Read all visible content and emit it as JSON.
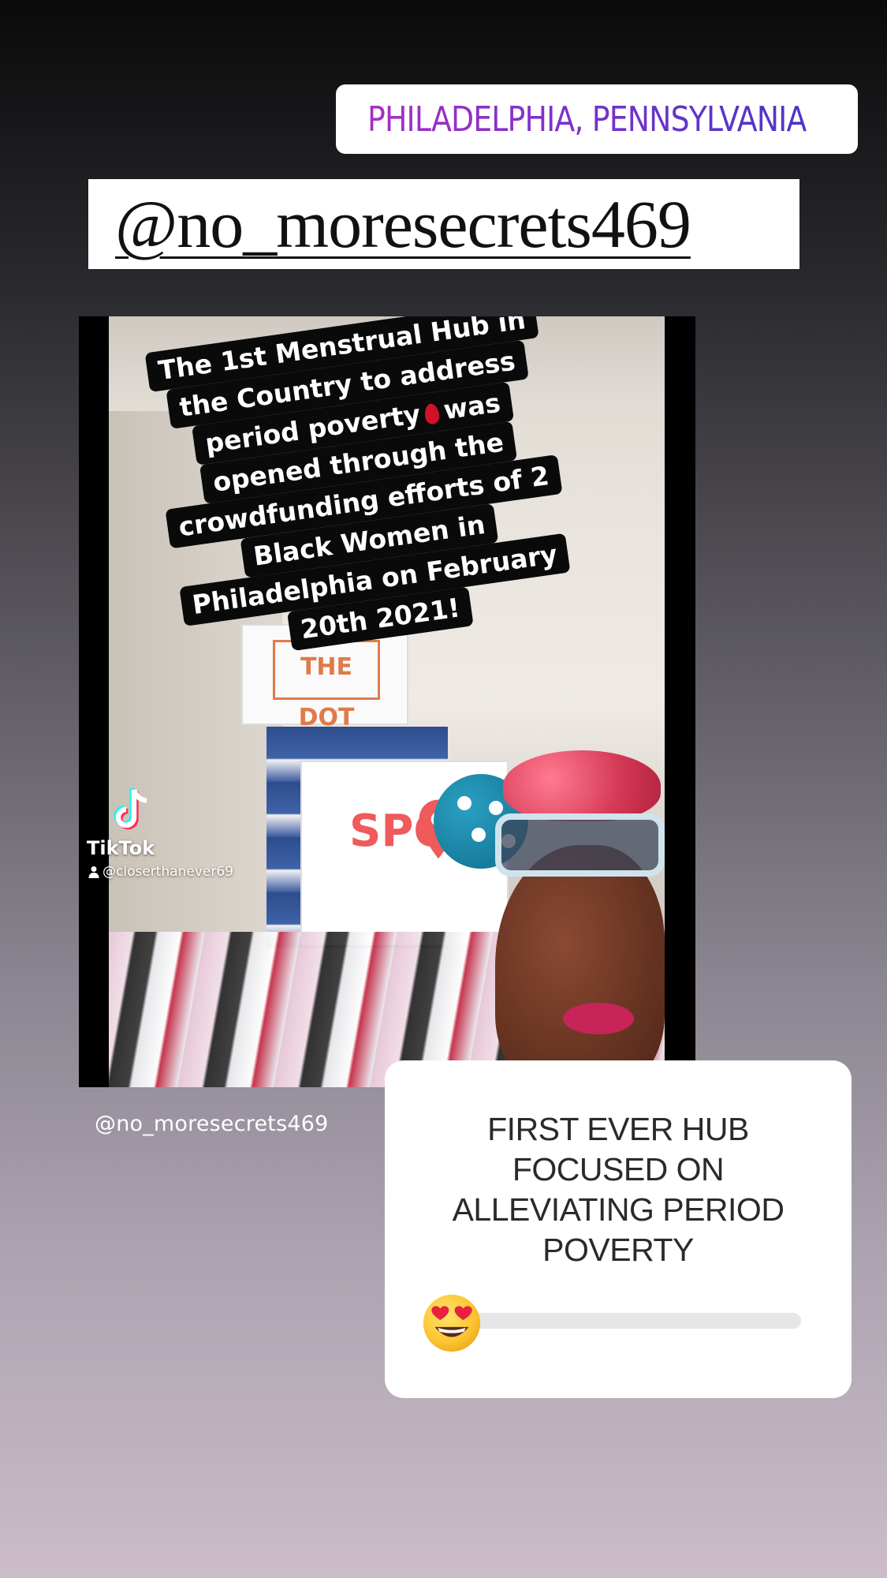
{
  "location_sticker": {
    "icon": "location-pin-icon",
    "text": "PHILADELPHIA, PENNSYLVANIA",
    "gradient_colors": [
      "#a62fc7",
      "#4b36c6"
    ]
  },
  "mention_sticker": {
    "text": "@no_moresecrets469"
  },
  "video": {
    "caption_lines": [
      "The 1st Menstrual Hub in",
      "the Country to address",
      "period poverty",
      "was",
      "opened through the",
      "crowdfunding efforts of 2",
      "Black Women in",
      "Philadelphia on February",
      "20th 2021!"
    ],
    "caption_emoji": "drop-of-blood-icon",
    "sign_text": "THE DOT",
    "box_text": "SPO",
    "watermark": {
      "brand": "TikTok",
      "user": "@closerthanever69"
    },
    "play_icon": "play-icon",
    "handle": "@no_moresecrets469"
  },
  "poll": {
    "question": "FIRST EVER HUB FOCUSED ON ALLEVIATING PERIOD POVERTY",
    "emoji": "heart-eyes-emoji-icon",
    "slider_value": 0
  }
}
